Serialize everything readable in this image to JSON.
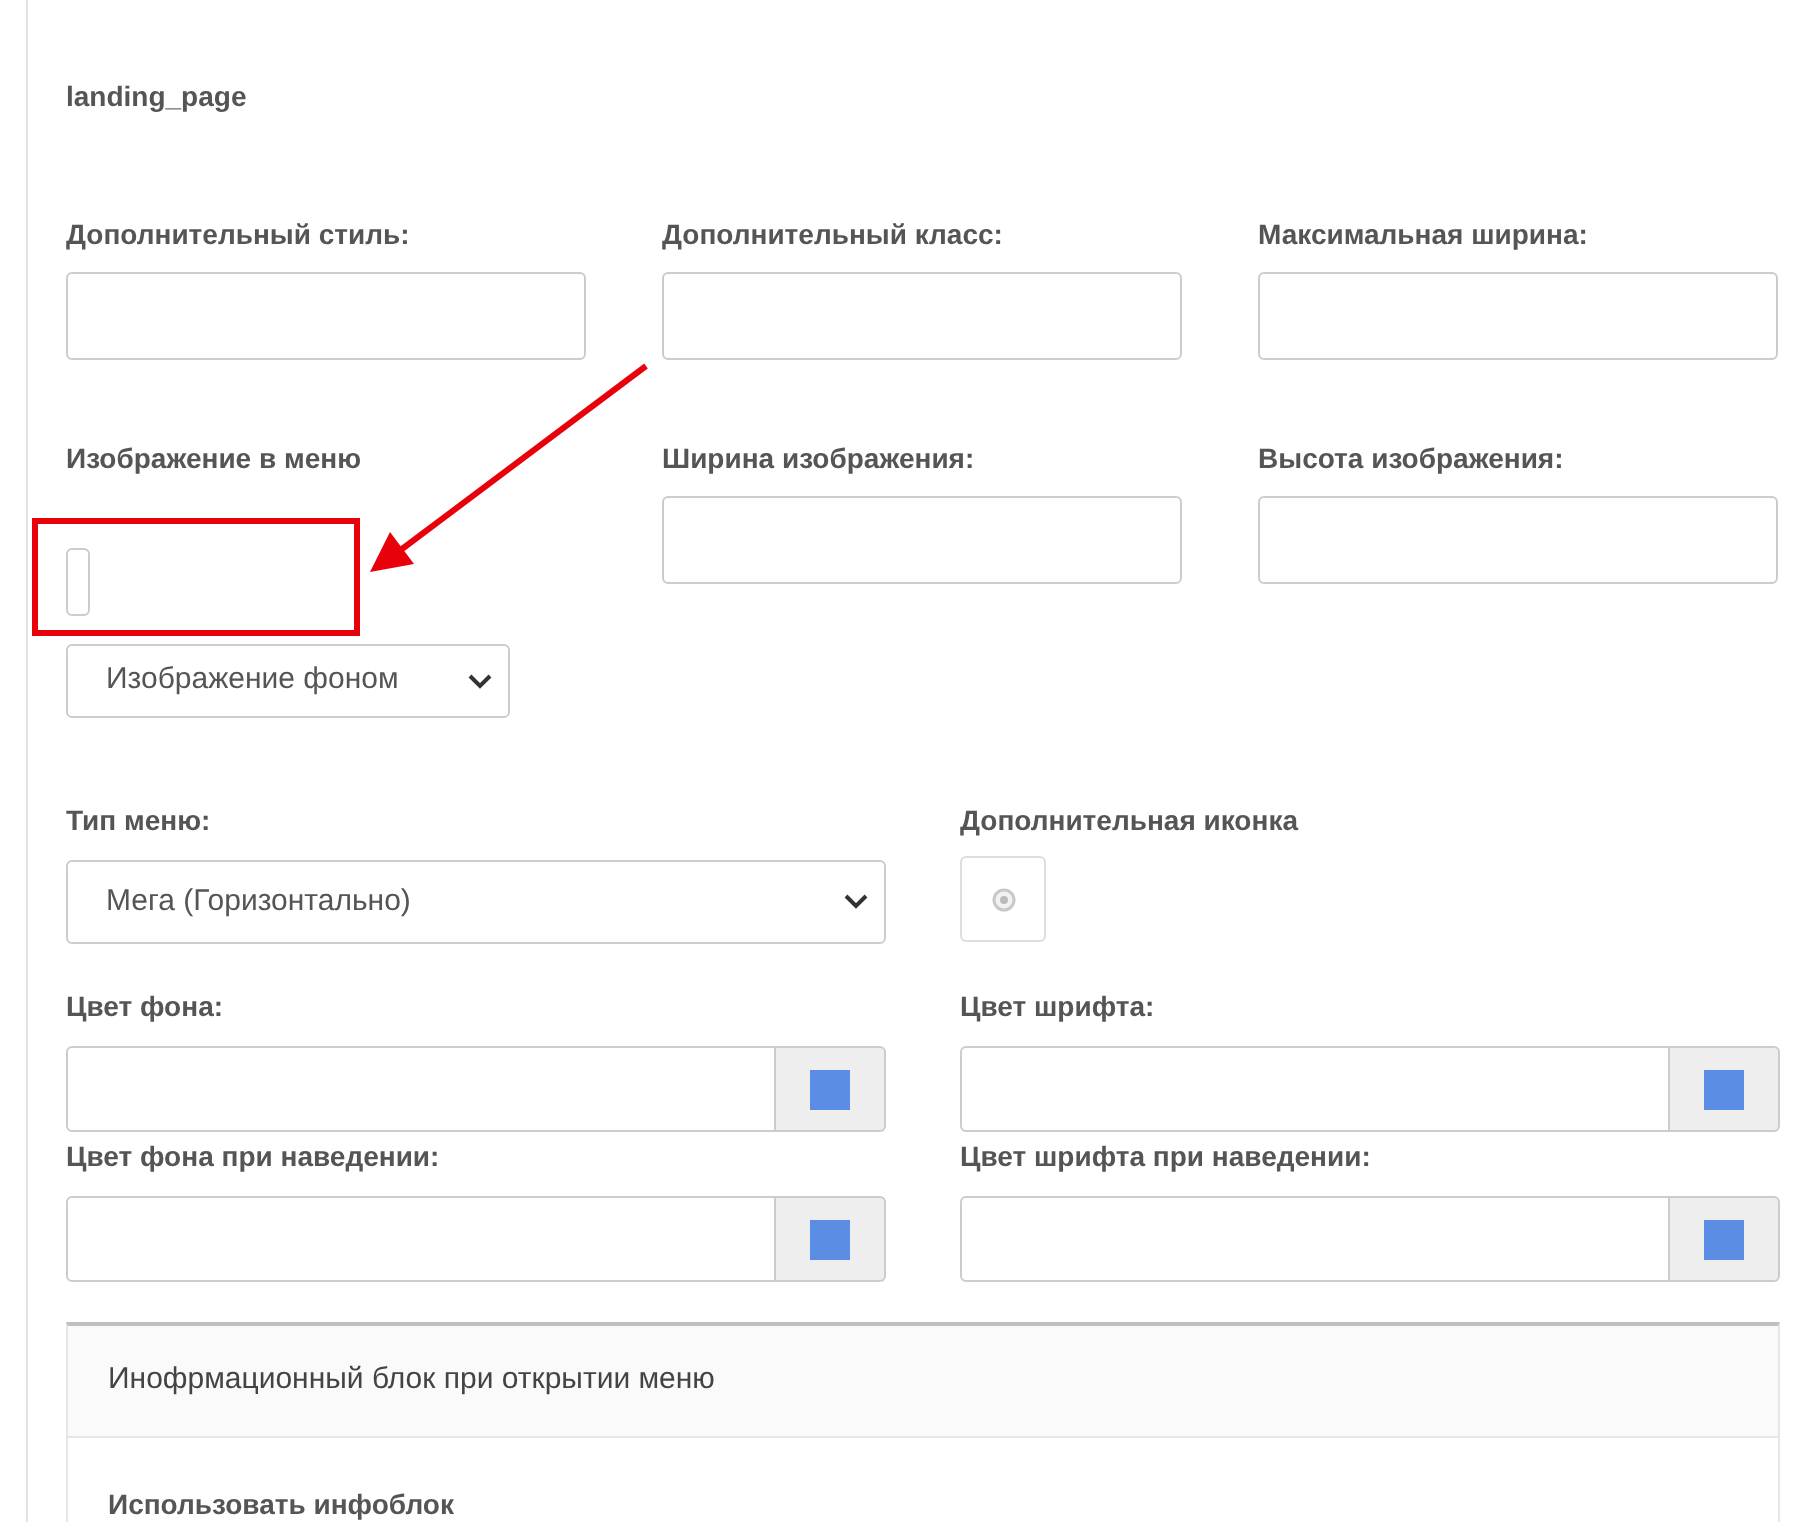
{
  "title": "landing_page",
  "rows": [
    [
      {
        "kind": "text",
        "label": "Дополнительный стиль:"
      },
      {
        "kind": "text",
        "label": "Дополнительный класс:"
      },
      {
        "kind": "text",
        "label": "Максимальная ширина:"
      }
    ],
    [
      {
        "kind": "image",
        "label": "Изображение в меню",
        "select": "Изображение фоном"
      },
      {
        "kind": "text",
        "label": "Ширина изображения:"
      },
      {
        "kind": "text",
        "label": "Высота изображения:"
      }
    ],
    [
      {
        "kind": "select",
        "label": "Тип меню:",
        "value": "Мега (Горизонтально)"
      },
      {
        "kind": "icon",
        "label": "Дополнительная иконка"
      }
    ],
    [
      {
        "kind": "color",
        "label": "Цвет фона:"
      },
      {
        "kind": "color",
        "label": "Цвет шрифта:"
      }
    ],
    [
      {
        "kind": "color",
        "label": "Цвет фона при наведении:"
      },
      {
        "kind": "color",
        "label": "Цвет шрифта при наведении:"
      }
    ]
  ],
  "panel": {
    "header": "Инофрмационный блок при открытии меню",
    "label": "Использовать инфоблок"
  }
}
